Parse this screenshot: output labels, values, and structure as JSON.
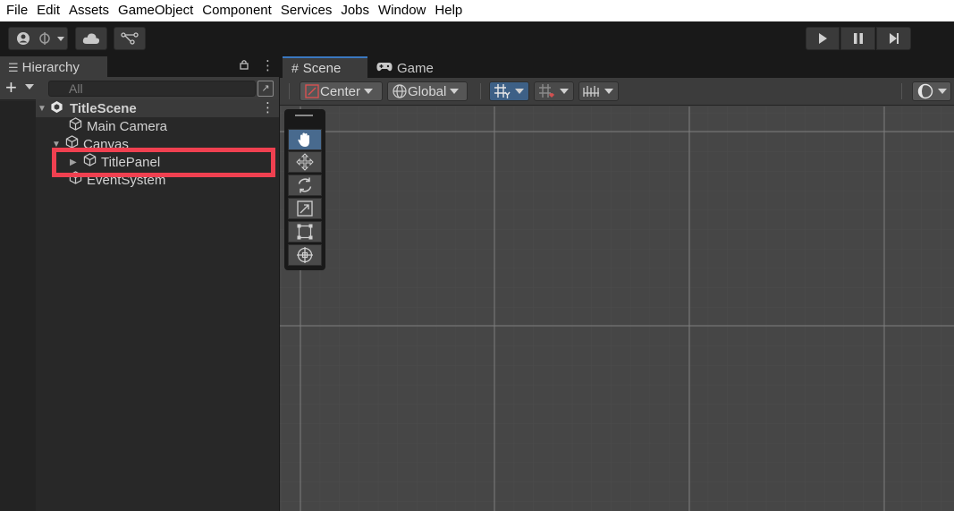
{
  "menu": [
    "File",
    "Edit",
    "Assets",
    "GameObject",
    "Component",
    "Services",
    "Jobs",
    "Window",
    "Help"
  ],
  "toolbar": {
    "account_icon": "account-icon",
    "cloud_icon": "cloud-icon",
    "collab_icon": "collab-icon",
    "play_icon": "play-icon",
    "pause_icon": "pause-icon",
    "step_icon": "step-icon"
  },
  "hierarchy": {
    "tab_label": "Hierarchy",
    "search_placeholder": "All",
    "rows": {
      "scene": "TitleScene",
      "main_camera": "Main Camera",
      "canvas": "Canvas",
      "title_panel": "TitlePanel",
      "event_system": "EventSystem"
    },
    "highlight_color": "#f04050"
  },
  "scene": {
    "tab_label": "Scene",
    "game_tab_label": "Game",
    "pivot_label": "Center",
    "space_label": "Global",
    "accent_color": "#3a78c0"
  }
}
